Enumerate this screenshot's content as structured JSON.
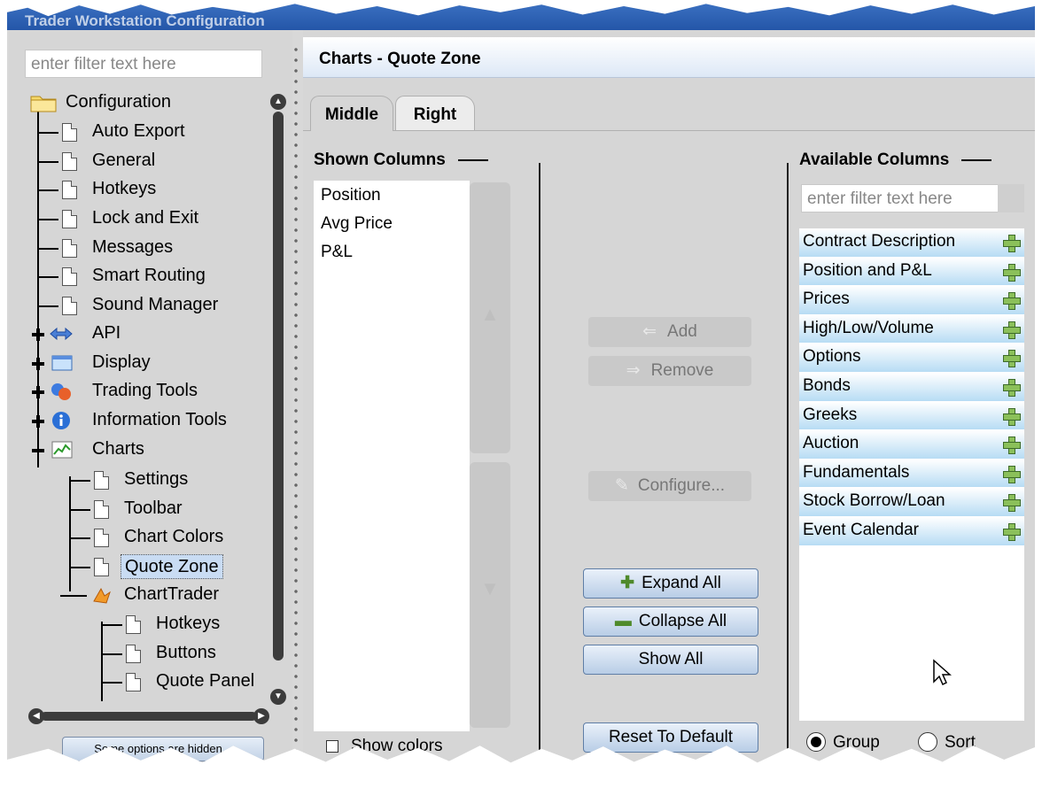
{
  "window": {
    "title_fragment": "Trader Workstation Configuration"
  },
  "sidebar": {
    "filter_placeholder": "enter filter text here",
    "tree": [
      {
        "label": "Configuration",
        "icon": "folder-icon"
      },
      {
        "label": "Auto Export"
      },
      {
        "label": "General"
      },
      {
        "label": "Hotkeys"
      },
      {
        "label": "Lock and Exit"
      },
      {
        "label": "Messages"
      },
      {
        "label": "Smart Routing"
      },
      {
        "label": "Sound Manager"
      },
      {
        "label": "API",
        "icon": "arrows-icon"
      },
      {
        "label": "Display",
        "icon": "display-icon"
      },
      {
        "label": "Trading Tools",
        "icon": "trading-tools-icon"
      },
      {
        "label": "Information Tools",
        "icon": "info-icon"
      },
      {
        "label": "Charts",
        "icon": "chart-icon"
      },
      {
        "label": "Settings"
      },
      {
        "label": "Toolbar"
      },
      {
        "label": "Chart Colors"
      },
      {
        "label": "Quote Zone",
        "selected": true
      },
      {
        "label": "ChartTrader",
        "icon": "charttrader-icon"
      },
      {
        "label": "Hotkeys"
      },
      {
        "label": "Buttons"
      },
      {
        "label": "Quote Panel"
      }
    ],
    "hidden_options_button": "Some options are hidden..."
  },
  "main": {
    "header_title": "Charts - Quote Zone",
    "tabs": [
      {
        "label": "Middle",
        "active": true
      },
      {
        "label": "Right",
        "active": false
      }
    ],
    "shown": {
      "title": "Shown Columns",
      "items": [
        "Position",
        "Avg Price",
        "P&L"
      ],
      "show_colors_label": "Show colors"
    },
    "actions": {
      "add": "Add",
      "remove": "Remove",
      "configure": "Configure...",
      "expand_all": "Expand All",
      "collapse_all": "Collapse All",
      "show_all": "Show All",
      "reset": "Reset To Default"
    },
    "available": {
      "title": "Available Columns",
      "filter_placeholder": "enter filter text here",
      "categories": [
        "Contract Description",
        "Position and P&L",
        "Prices",
        "High/Low/Volume",
        "Options",
        "Bonds",
        "Greeks",
        "Auction",
        "Fundamentals",
        "Stock Borrow/Loan",
        "Event Calendar"
      ],
      "group_label": "Group",
      "sort_label": "Sort",
      "selected_mode": "Group"
    }
  },
  "colors": {
    "accent_blue": "#c9dcf3",
    "category_gradient": "#b7dcf4",
    "plus_green": "#8bc05a"
  }
}
